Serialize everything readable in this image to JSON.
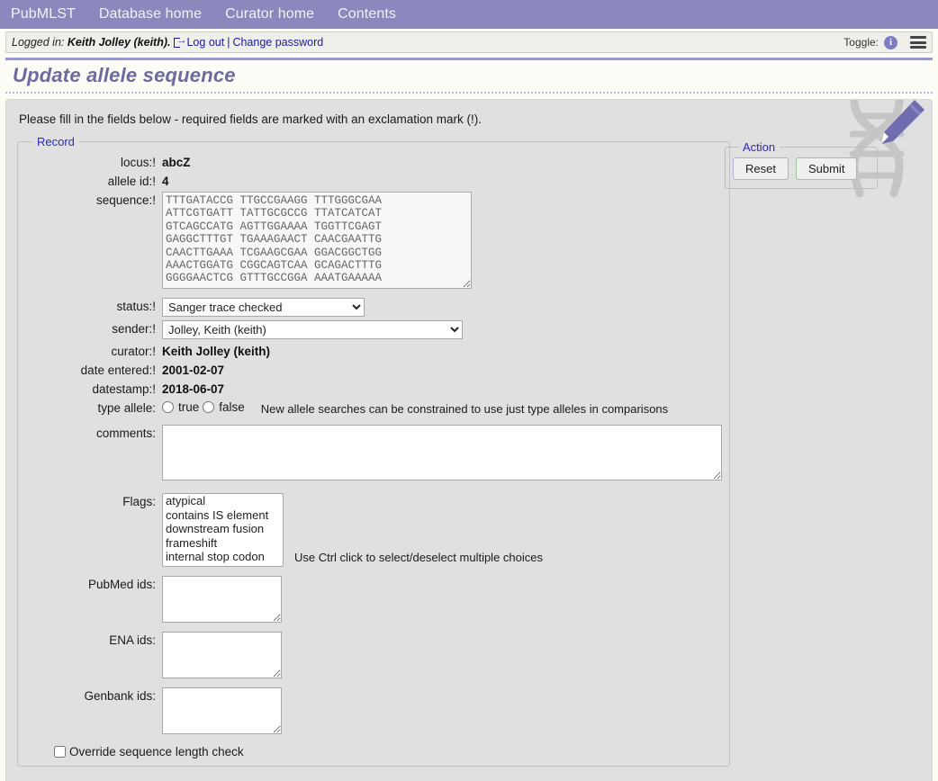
{
  "nav": {
    "items": [
      {
        "label": "PubMLST",
        "name": "nav-pubmlst"
      },
      {
        "label": "Database home",
        "name": "nav-database-home"
      },
      {
        "label": "Curator home",
        "name": "nav-curator-home"
      },
      {
        "label": "Contents",
        "name": "nav-contents"
      }
    ]
  },
  "loginbar": {
    "prefix": "Logged in:",
    "user": "Keith Jolley (keith).",
    "logout_label": "Log out",
    "separator": "|",
    "change_password_label": "Change password",
    "toggle_label": "Toggle:",
    "info_glyph": "i"
  },
  "page": {
    "title": "Update allele sequence",
    "intro": "Please fill in the fields below - required fields are marked with an exclamation mark (!)."
  },
  "record": {
    "legend": "Record",
    "locus": {
      "label": "locus:!",
      "value": "abcZ"
    },
    "allele_id": {
      "label": "allele id:!",
      "value": "4"
    },
    "sequence": {
      "label": "sequence:!",
      "value": "TTTGATACCG TTGCCGAAGG TTTGGGCGAA\nATTCGTGATT TATTGCGCCG TTATCATCAT\nGTCAGCCATG AGTTGGAAAA TGGTTCGAGT\nGAGGCTTTGT TGAAAGAACT CAACGAATTG\nCAACTTGAAA TCGAAGCGAA GGACGGCTGG\nAAACTGGATG CGGCAGTCAA GCAGACTTTG\nGGGGAACTCG GTTTGCCGGA AAATGAAAAA"
    },
    "status": {
      "label": "status:!",
      "selected": "Sanger trace checked",
      "options": [
        "Sanger trace checked"
      ]
    },
    "sender": {
      "label": "sender:!",
      "selected": "Jolley, Keith (keith)",
      "options": [
        "Jolley, Keith (keith)"
      ]
    },
    "curator": {
      "label": "curator:!",
      "value": "Keith Jolley (keith)"
    },
    "date_entered": {
      "label": "date entered:!",
      "value": "2001-02-07"
    },
    "datestamp": {
      "label": "datestamp:!",
      "value": "2018-06-07"
    },
    "type_allele": {
      "label": "type allele:",
      "true_label": "true",
      "false_label": "false",
      "hint": "New allele searches can be constrained to use just type alleles in comparisons"
    },
    "comments": {
      "label": "comments:",
      "value": ""
    },
    "flags": {
      "label": "Flags:",
      "options": [
        "atypical",
        "contains IS element",
        "downstream fusion",
        "frameshift",
        "internal stop codon"
      ],
      "hint": "Use Ctrl click to select/deselect multiple choices"
    },
    "pubmed_ids": {
      "label": "PubMed ids:",
      "value": ""
    },
    "ena_ids": {
      "label": "ENA ids:",
      "value": ""
    },
    "genbank_ids": {
      "label": "Genbank ids:",
      "value": ""
    },
    "override": {
      "label": "Override sequence length check",
      "checked": false
    }
  },
  "action": {
    "legend": "Action",
    "reset_label": "Reset",
    "submit_label": "Submit"
  },
  "colors": {
    "nav_bar": "#8a88bd",
    "title_text": "#6c6a9e",
    "link": "#1a1aa8",
    "legend": "#2b2bbf",
    "panel_bg": "#e0e0e0",
    "page_bg": "#fdfdf5",
    "reset_border": "#b3b1d6",
    "submit_border": "#9ec79b",
    "info_badge": "#7f7cc4",
    "watermark_helix": "#c5c5c5",
    "watermark_pencil": "#6f6cb0"
  }
}
